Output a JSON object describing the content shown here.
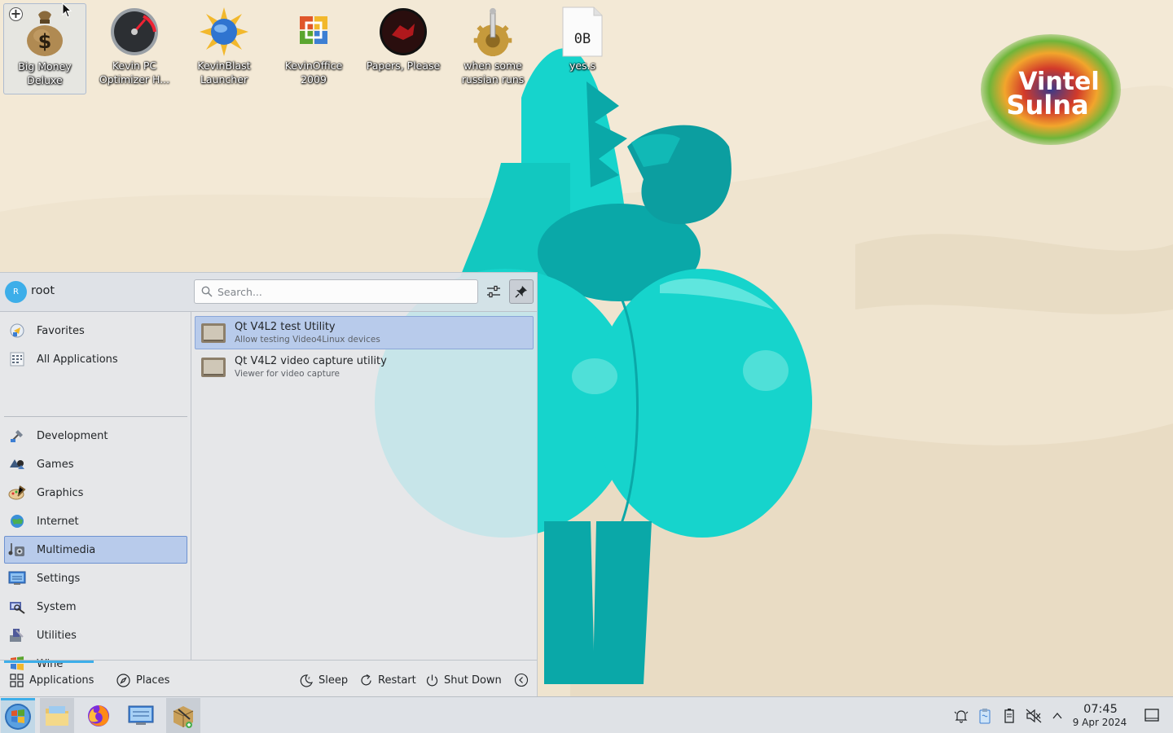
{
  "desktop": {
    "icons": [
      {
        "label": "Big Money Deluxe",
        "icon": "money-bag-icon"
      },
      {
        "label": "Kevin PC Optimizer H...",
        "icon": "speedometer-icon"
      },
      {
        "label": "KevinBlast Launcher",
        "icon": "globe-burst-icon"
      },
      {
        "label": "KevinOffice 2009",
        "icon": "office-logo-icon"
      },
      {
        "label": "Papers, Please",
        "icon": "papers-please-seal-icon"
      },
      {
        "label": "when some russian runs a...",
        "icon": "gear-joystick-icon"
      },
      {
        "label": "yes.s",
        "icon": "file-icon",
        "badge": "0B"
      }
    ],
    "logo_text_line1": "Vintel",
    "logo_text_line2": "Sulna"
  },
  "launcher": {
    "user": {
      "initial": "R",
      "name": "root"
    },
    "search": {
      "placeholder": "Search...",
      "value": ""
    },
    "categories": [
      {
        "label": "Favorites",
        "icon": "favorites-icon"
      },
      {
        "label": "All Applications",
        "icon": "all-applications-icon"
      },
      {
        "label": "Development",
        "icon": "development-icon"
      },
      {
        "label": "Games",
        "icon": "games-icon"
      },
      {
        "label": "Graphics",
        "icon": "graphics-icon"
      },
      {
        "label": "Internet",
        "icon": "internet-icon"
      },
      {
        "label": "Multimedia",
        "icon": "multimedia-icon",
        "selected": true
      },
      {
        "label": "Settings",
        "icon": "settings-icon"
      },
      {
        "label": "System",
        "icon": "system-icon"
      },
      {
        "label": "Utilities",
        "icon": "utilities-icon"
      },
      {
        "label": "Wine",
        "icon": "wine-icon"
      }
    ],
    "results": [
      {
        "title": "Qt V4L2 test Utility",
        "description": "Allow testing Video4Linux devices",
        "highlighted": true
      },
      {
        "title": "Qt V4L2 video capture utility",
        "description": "Viewer for video capture"
      }
    ],
    "footer": {
      "tabs": [
        {
          "label": "Applications",
          "active": true
        },
        {
          "label": "Places"
        }
      ],
      "power": {
        "sleep": "Sleep",
        "restart": "Restart",
        "shutdown": "Shut Down"
      }
    }
  },
  "taskbar": {
    "items": [
      "start-menu",
      "file-manager",
      "firefox",
      "system-settings",
      "package-installer"
    ],
    "tray_icons": [
      "notifications-icon",
      "clipboard-icon",
      "battery-icon",
      "volume-muted-icon",
      "expand-tray-icon"
    ],
    "clock": {
      "time": "07:45",
      "date": "9 Apr 2024"
    }
  },
  "colors": {
    "accent": "#3daee9",
    "selection": "#b8cbeb",
    "wallpaper_bg": "#efe4cf",
    "character": "#18d4cc"
  }
}
